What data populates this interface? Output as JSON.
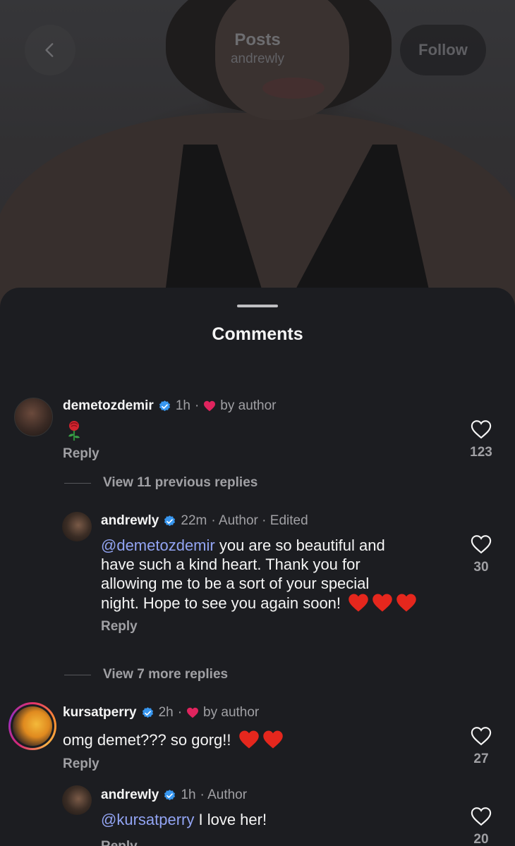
{
  "header": {
    "title": "Posts",
    "subtitle": "andrewly",
    "follow_label": "Follow"
  },
  "sheet": {
    "title": "Comments"
  },
  "comments": [
    {
      "username": "demetozdemir",
      "time": "1h",
      "separator": "·",
      "liked_by": "by author",
      "text_emoji": "rose-emoji",
      "reply_label": "Reply",
      "like_count": "123",
      "view_previous": "View 11 previous replies",
      "replies": [
        {
          "username": "andrewly",
          "time": "22m",
          "tags": "· Author · Edited",
          "mention": "@demetozdemir",
          "line1": " you are so beautiful and",
          "line2": "have such a kind heart. Thank you for",
          "line3": "allowing me to be a sort of your special",
          "line4": "night. Hope to see you again soon!",
          "reply_label": "Reply",
          "like_count": "30"
        }
      ],
      "view_more": "View 7 more replies"
    },
    {
      "username": "kursatperry",
      "time": "2h",
      "separator": "·",
      "liked_by": "by author",
      "text": "omg demet??? so gorg!!",
      "reply_label": "Reply",
      "like_count": "27",
      "replies": [
        {
          "username": "andrewly",
          "time": "1h",
          "tags": "· Author",
          "mention": "@kursatperry",
          "text": " I love her!",
          "reply_label": "Reply",
          "like_count": "20"
        }
      ]
    }
  ],
  "colors": {
    "background": "#1c1d21",
    "mention": "#92a4f3",
    "verified": "#3897f0",
    "heart": "#e0245e"
  }
}
